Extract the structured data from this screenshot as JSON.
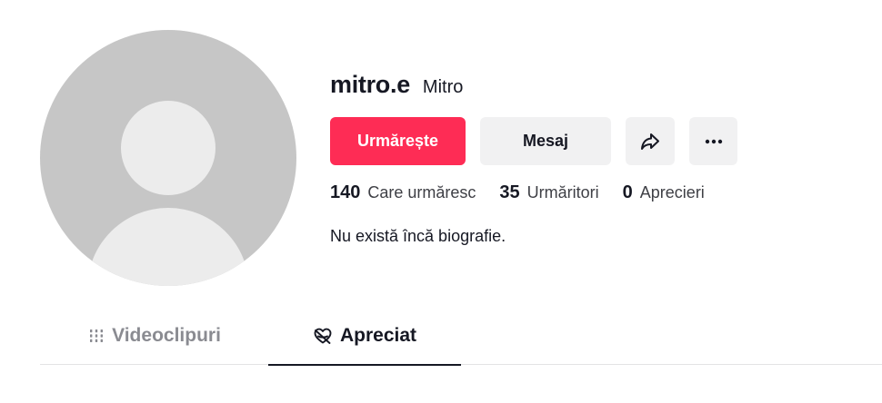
{
  "profile": {
    "username": "mitro.e",
    "nickname": "Mitro",
    "bio": "Nu există încă biografie."
  },
  "actions": {
    "follow_label": "Urmărește",
    "message_label": "Mesaj",
    "share_icon": "share-arrow-icon",
    "more_icon": "more-dots-icon"
  },
  "stats": [
    {
      "value": "140",
      "label": "Care urmăresc"
    },
    {
      "value": "35",
      "label": "Urmăritori"
    },
    {
      "value": "0",
      "label": "Aprecieri"
    }
  ],
  "tabs": [
    {
      "label": "Videoclipuri",
      "icon": "grid-icon",
      "active": false
    },
    {
      "label": "Apreciat",
      "icon": "heart-hidden-icon",
      "active": true
    }
  ],
  "colors": {
    "accent": "#fe2c55",
    "text": "#161823",
    "muted": "#8a8b91",
    "button_bg": "#f1f1f2",
    "avatar_bg": "#c6c6c6"
  }
}
